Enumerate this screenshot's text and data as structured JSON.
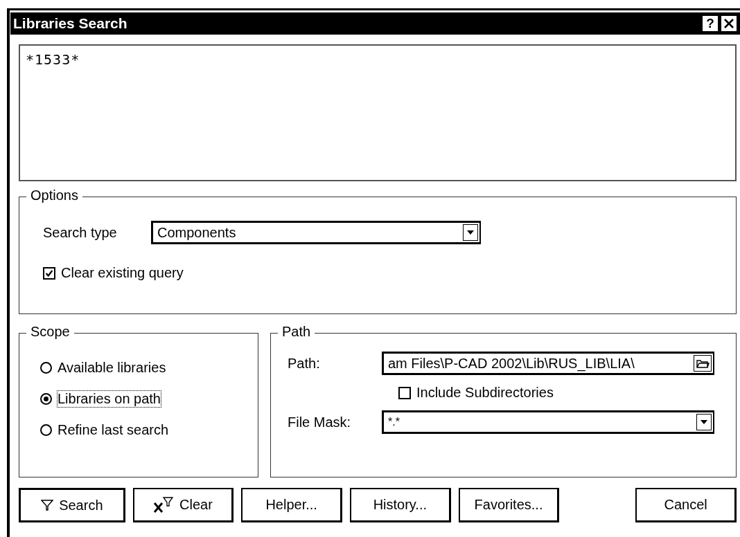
{
  "window": {
    "title": "Libraries Search",
    "help": "?"
  },
  "query": "*1533*",
  "options": {
    "title": "Options",
    "search_type": {
      "label": "Search type",
      "value": "Components"
    },
    "clear_existing": {
      "label": "Clear existing query",
      "checked": true
    }
  },
  "scope": {
    "title": "Scope",
    "items": [
      {
        "label": "Available libraries",
        "selected": false
      },
      {
        "label": "Libraries on path",
        "selected": true
      },
      {
        "label": "Refine last search",
        "selected": false
      }
    ]
  },
  "path": {
    "title": "Path",
    "path": {
      "label": "Path:",
      "value": "am Files\\P-CAD 2002\\Lib\\RUS_LIB\\LIA\\"
    },
    "include_subdirs": {
      "label": "Include Subdirectories",
      "checked": false
    },
    "file_mask": {
      "label": "File Mask:",
      "value": "*.*"
    }
  },
  "buttons": [
    {
      "label": "Search",
      "kind": "search"
    },
    {
      "label": "Clear",
      "kind": "clear"
    },
    {
      "label": "Helper...",
      "kind": "plain"
    },
    {
      "label": "History...",
      "kind": "plain"
    },
    {
      "label": "Favorites...",
      "kind": "plain"
    },
    {
      "label": "Cancel",
      "kind": "cancel"
    }
  ]
}
